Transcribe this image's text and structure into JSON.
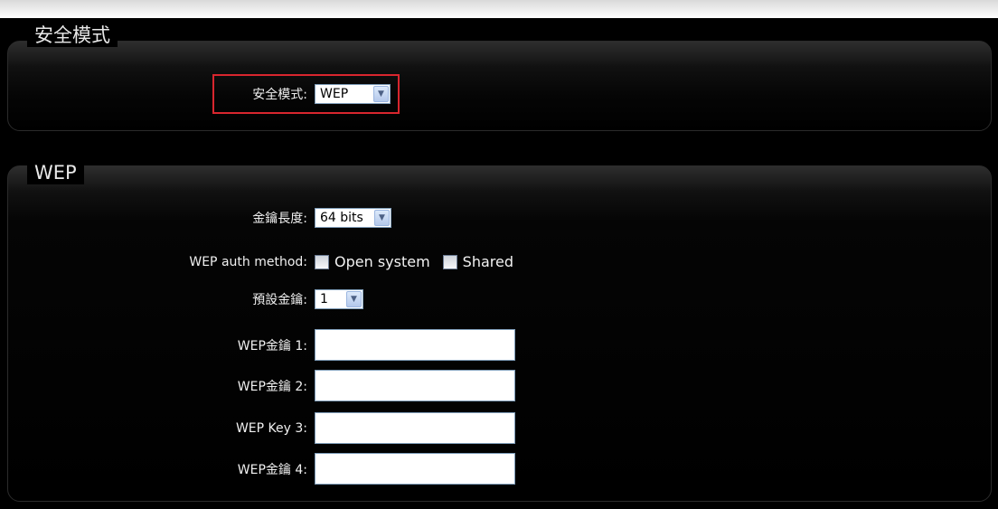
{
  "security_mode_section": {
    "legend": "安全模式",
    "mode_label": "安全模式:",
    "mode_value": "WEP"
  },
  "wep_section": {
    "legend": "WEP",
    "key_length_label": "金鑰長度:",
    "key_length_value": "64 bits",
    "auth_method_label": "WEP auth method:",
    "auth_options": [
      {
        "label": "Open system",
        "checked": false
      },
      {
        "label": "Shared",
        "checked": false
      }
    ],
    "default_key_label": "預設金鑰:",
    "default_key_value": "1",
    "keys": [
      {
        "label": "WEP金鑰 1:",
        "value": ""
      },
      {
        "label": "WEP金鑰 2:",
        "value": ""
      },
      {
        "label": "WEP Key 3:",
        "value": ""
      },
      {
        "label": "WEP金鑰 4:",
        "value": ""
      }
    ]
  },
  "colors": {
    "background": "#000000",
    "highlight_border": "#d8262e",
    "text": "#ffffff"
  },
  "icons": {
    "dropdown": "chevron-down-icon"
  }
}
